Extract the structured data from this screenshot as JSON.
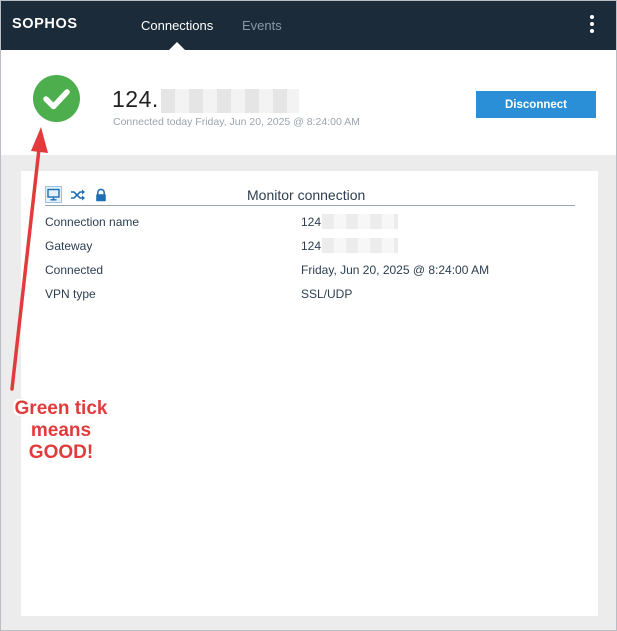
{
  "app": {
    "logo": "SOPHOS"
  },
  "nav": {
    "tabs": [
      {
        "label": "Connections",
        "active": true
      },
      {
        "label": "Events",
        "active": false
      }
    ],
    "menu_icon": "kebab-menu-icon"
  },
  "status": {
    "icon": "green-check-icon",
    "connection_prefix": "124.",
    "connected_text": "Connected today Friday, Jun 20, 2025 @ 8:24:00 AM",
    "disconnect_label": "Disconnect"
  },
  "monitor": {
    "title": "Monitor connection",
    "icons": [
      "monitor-icon",
      "shuffle-icon",
      "lock-icon"
    ],
    "rows": [
      {
        "key": "Connection name",
        "value": "124"
      },
      {
        "key": "Gateway",
        "value": "124"
      },
      {
        "key": "Connected",
        "value": "Friday, Jun 20, 2025 @ 8:24:00 AM"
      },
      {
        "key": "VPN type",
        "value": "SSL/UDP"
      }
    ]
  },
  "annotation": {
    "lines": [
      "Green tick",
      "means",
      "GOOD!"
    ]
  },
  "colors": {
    "topbar": "#1c2b39",
    "accent": "#2b8fd8",
    "success": "#4cae4c",
    "annotation": "#e23b3b"
  }
}
